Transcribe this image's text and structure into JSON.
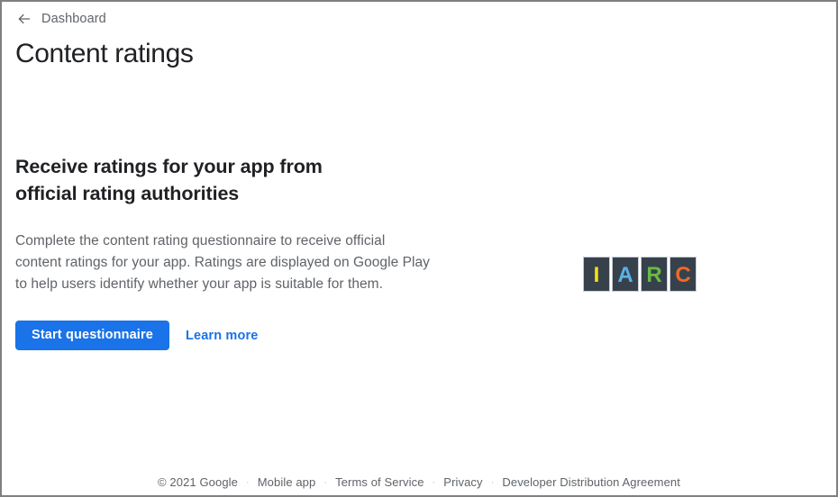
{
  "breadcrumb": {
    "back_icon": "arrow-left-icon",
    "label": "Dashboard"
  },
  "header": {
    "title": "Content ratings"
  },
  "main": {
    "headline": "Receive ratings for your app from official rating authorities",
    "body": "Complete the content rating questionnaire to receive official content ratings for your app. Ratings are displayed on Google Play to help users identify whether your app is suitable for them.",
    "primary_button": "Start questionnaire",
    "secondary_link": "Learn more"
  },
  "logo": {
    "name": "iarc-logo",
    "tile_background": "#37414c",
    "tile_border": "#c9ccd1",
    "letters": [
      {
        "char": "I",
        "color": "#f5e11c"
      },
      {
        "char": "A",
        "color": "#5bb3e8"
      },
      {
        "char": "R",
        "color": "#69bb45"
      },
      {
        "char": "C",
        "color": "#ef6a28"
      }
    ]
  },
  "footer": {
    "separator": "·",
    "items": [
      {
        "label": "© 2021 Google",
        "link": false
      },
      {
        "label": "Mobile app",
        "link": true
      },
      {
        "label": "Terms of Service",
        "link": true
      },
      {
        "label": "Privacy",
        "link": true
      },
      {
        "label": "Developer Distribution Agreement",
        "link": true
      }
    ]
  },
  "colors": {
    "accent": "#1a73e8",
    "text_primary": "#202124",
    "text_secondary": "#5f6368",
    "page_border": "#808080"
  }
}
